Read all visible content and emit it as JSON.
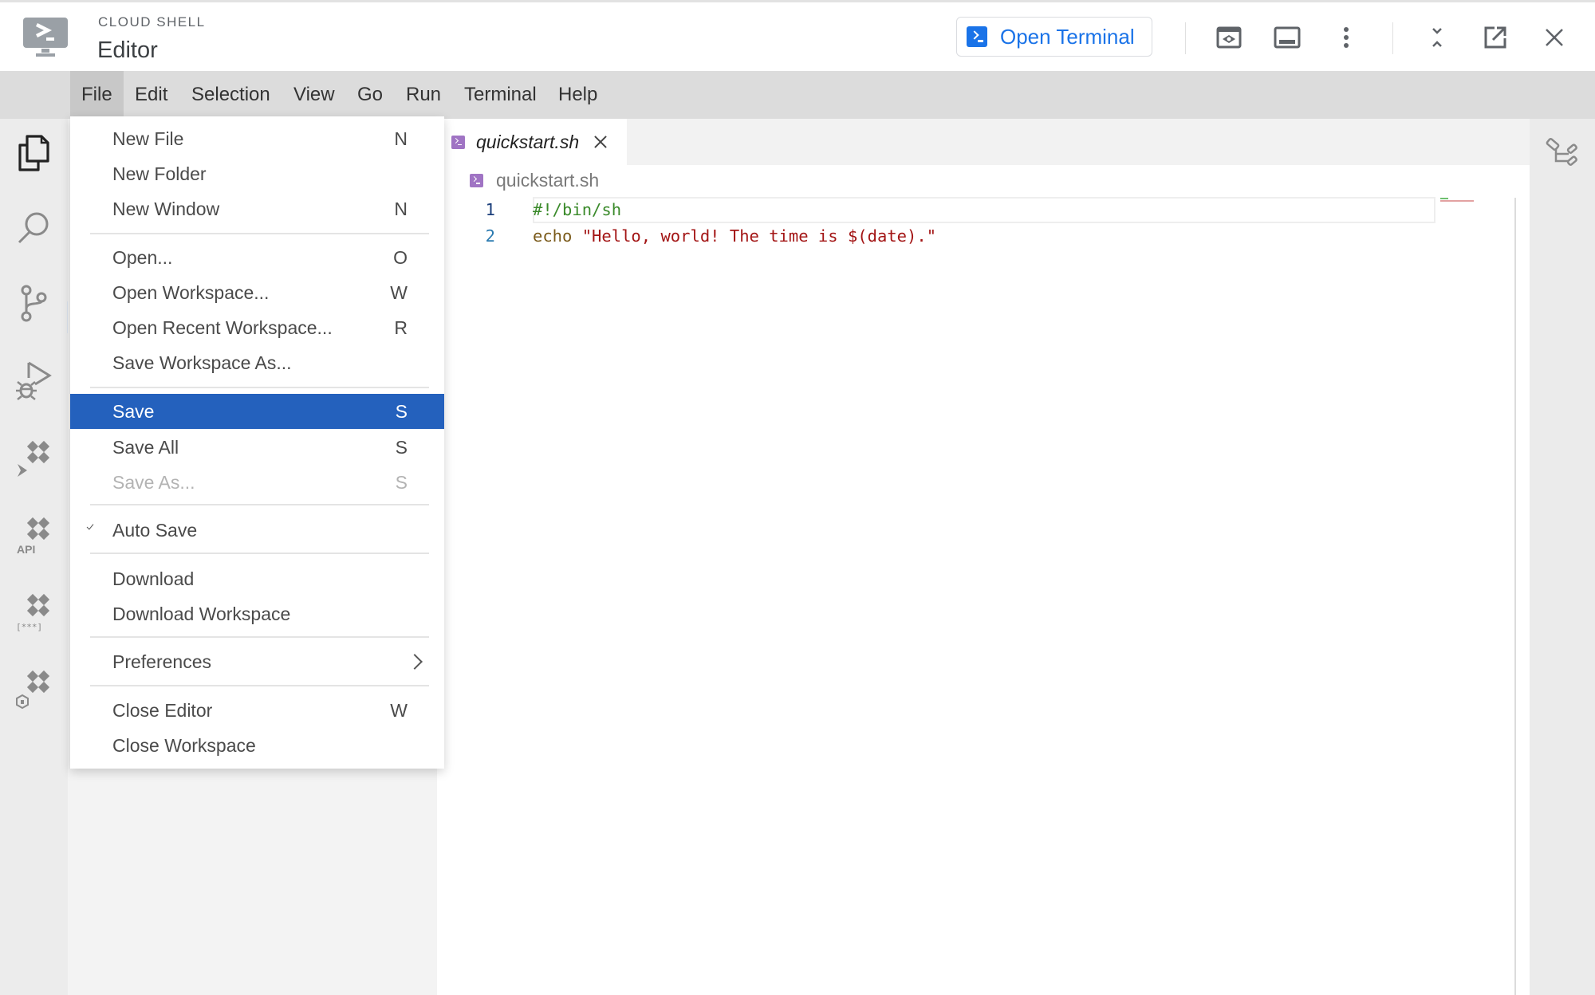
{
  "header": {
    "kicker": "CLOUD SHELL",
    "title": "Editor",
    "open_terminal_label": "Open Terminal",
    "icons": [
      "web-preview-icon",
      "toggle-panel-icon",
      "more-vert-icon",
      "minimize-icon",
      "open-new-window-icon",
      "close-icon"
    ]
  },
  "colors": {
    "accent": "#1a73e8",
    "menu_selected": "#2461bd",
    "shell_file_icon": "#a074c4",
    "code_comment": "#3a8a2a",
    "code_builtin": "#7a5a1a",
    "code_string": "#a31515",
    "line_number_current": "#1a3d7a",
    "line_number": "#2a7ab0"
  },
  "menubar": {
    "items": [
      {
        "label": "File",
        "active": true
      },
      {
        "label": "Edit"
      },
      {
        "label": "Selection"
      },
      {
        "label": "View"
      },
      {
        "label": "Go"
      },
      {
        "label": "Run"
      },
      {
        "label": "Terminal"
      },
      {
        "label": "Help"
      }
    ]
  },
  "activity_bar": {
    "items": [
      "explorer-icon",
      "search-icon",
      "source-control-icon",
      "run-debug-icon",
      "cloud-code-deploy-icon",
      "cloud-code-api-icon",
      "secret-manager-icon",
      "cloud-code-kubernetes-icon"
    ],
    "api_label": "API",
    "secret_label": "[***]"
  },
  "file_menu": {
    "items": [
      {
        "label": "New File",
        "key": "N"
      },
      {
        "label": "New Folder",
        "key": ""
      },
      {
        "label": "New Window",
        "key": "N"
      },
      {
        "separator": true
      },
      {
        "label": "Open...",
        "key": "O"
      },
      {
        "label": "Open Workspace...",
        "key": "W"
      },
      {
        "label": "Open Recent Workspace...",
        "key": "R"
      },
      {
        "label": "Save Workspace As...",
        "key": ""
      },
      {
        "separator": true
      },
      {
        "label": "Save",
        "key": "S",
        "selected": true
      },
      {
        "label": "Save All",
        "key": "S"
      },
      {
        "label": "Save As...",
        "key": "S",
        "disabled": true
      },
      {
        "separator": true
      },
      {
        "label": "Auto Save",
        "key": "",
        "checked": true
      },
      {
        "separator": true
      },
      {
        "label": "Download",
        "key": ""
      },
      {
        "label": "Download Workspace",
        "key": ""
      },
      {
        "separator": true
      },
      {
        "label": "Preferences",
        "key": "",
        "submenu": true
      },
      {
        "separator": true
      },
      {
        "label": "Close Editor",
        "key": "W"
      },
      {
        "label": "Close Workspace",
        "key": ""
      }
    ]
  },
  "editor": {
    "tab_label": "quickstart.sh",
    "breadcrumb": "quickstart.sh",
    "lines": [
      {
        "number": "1",
        "segments": [
          {
            "text": "#!/bin/sh",
            "kind": "comment"
          }
        ]
      },
      {
        "number": "2",
        "segments": [
          {
            "text": "echo ",
            "kind": "builtin"
          },
          {
            "text": "\"Hello, world! The time is $(date).\"",
            "kind": "string"
          }
        ]
      }
    ]
  }
}
